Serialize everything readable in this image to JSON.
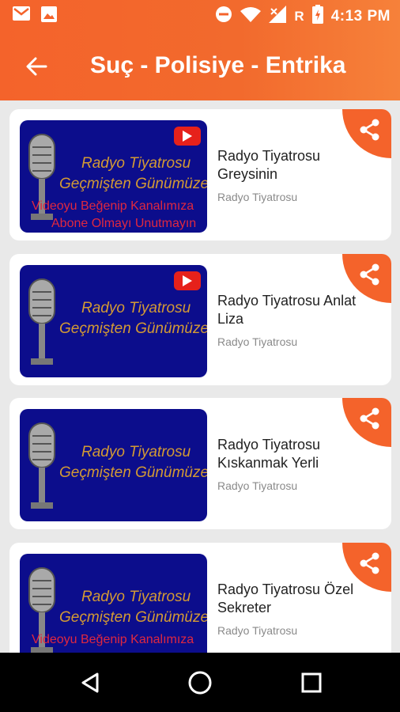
{
  "status_bar": {
    "time": "4:13 PM",
    "network_letter": "R",
    "icons_left": [
      "gmail-icon",
      "gallery-icon"
    ],
    "icons_right": [
      "do-not-disturb-icon",
      "wifi-icon",
      "signal-icon",
      "battery-charging-icon"
    ]
  },
  "toolbar": {
    "back_icon": "arrow-left-icon",
    "title": "Suç - Polisiye - Entrika"
  },
  "thumbnail_text": {
    "line1": "Radyo Tiyatrosu",
    "line2": "Geçmişten Günümüze",
    "line3": "Videoyu Beğenip Kanalımıza",
    "line4": "Abone Olmayı Unutmayın"
  },
  "items": [
    {
      "title": "Radyo Tiyatrosu Greysinin",
      "subtitle": "Radyo Tiyatrosu"
    },
    {
      "title": "Radyo Tiyatrosu Anlat Liza",
      "subtitle": "Radyo Tiyatrosu"
    },
    {
      "title": "Radyo Tiyatrosu Kıskanmak Yerli",
      "subtitle": "Radyo Tiyatrosu"
    },
    {
      "title": "Radyo Tiyatrosu Özel Sekreter",
      "subtitle": "Radyo Tiyatrosu"
    }
  ],
  "nav_bar": [
    "back-triangle-icon",
    "home-circle-icon",
    "recents-square-icon"
  ],
  "colors": {
    "accent": "#f4632b",
    "thumbnail_bg": "#0c0d8c",
    "thumb_gold": "#d39a34",
    "thumb_red": "#e0283f"
  }
}
